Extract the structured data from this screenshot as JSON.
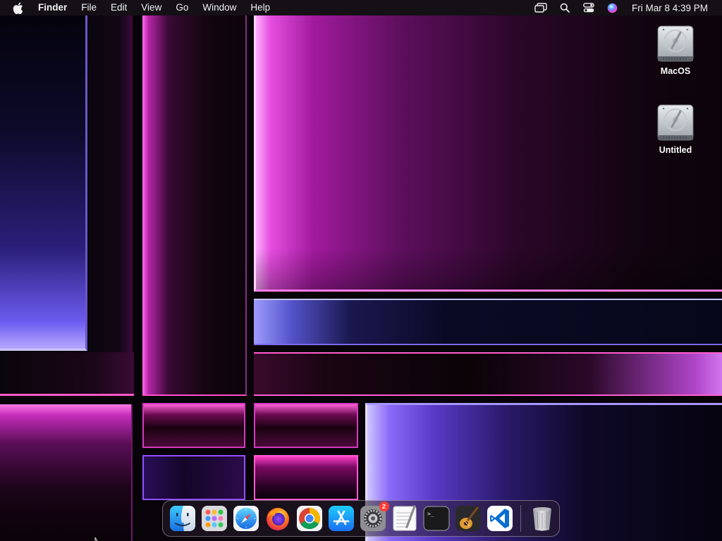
{
  "menubar": {
    "app_name": "Finder",
    "menus": [
      "File",
      "Edit",
      "View",
      "Go",
      "Window",
      "Help"
    ],
    "clock": "Fri Mar 8  4:39 PM",
    "status_icons": [
      "screen-mirroring-icon",
      "spotlight-search-icon",
      "control-center-icon",
      "siri-icon"
    ]
  },
  "desktop": {
    "icons": [
      {
        "label": "MacOS",
        "icon": "hard-drive-icon"
      },
      {
        "label": "Untitled",
        "icon": "hard-drive-icon"
      }
    ]
  },
  "dock": {
    "apps": [
      {
        "name": "finder",
        "icon": "finder-icon"
      },
      {
        "name": "launchpad",
        "icon": "launchpad-icon"
      },
      {
        "name": "safari",
        "icon": "safari-icon"
      },
      {
        "name": "firefox",
        "icon": "firefox-icon"
      },
      {
        "name": "chrome",
        "icon": "chrome-icon"
      },
      {
        "name": "app-store",
        "icon": "app-store-icon"
      },
      {
        "name": "system-settings",
        "icon": "system-settings-icon",
        "badge": "2"
      },
      {
        "name": "textedit",
        "icon": "textedit-icon"
      },
      {
        "name": "terminal",
        "icon": "terminal-icon"
      },
      {
        "name": "garageband",
        "icon": "garageband-icon"
      },
      {
        "name": "vscode",
        "icon": "vscode-icon"
      }
    ],
    "trash": {
      "name": "trash",
      "icon": "trash-icon"
    }
  },
  "colors": {
    "accent_pink": "#ff5fd0",
    "accent_violet": "#8a6af8",
    "badge_red": "#ff3b30"
  }
}
